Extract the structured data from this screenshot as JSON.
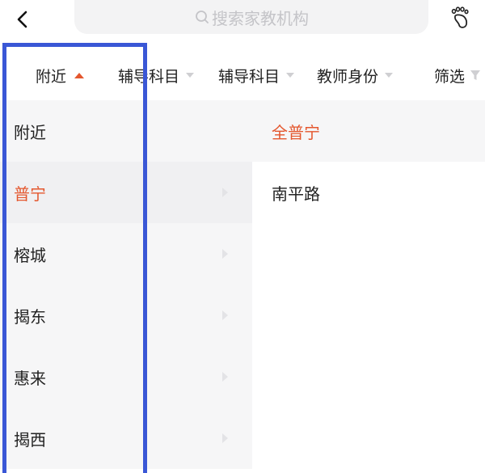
{
  "search": {
    "placeholder": "搜索家教机构"
  },
  "filters": [
    {
      "label": "附近",
      "state": "expanded"
    },
    {
      "label": "辅导科目",
      "state": "collapsed"
    },
    {
      "label": "辅导科目",
      "state": "collapsed"
    },
    {
      "label": "教师身份",
      "state": "collapsed"
    },
    {
      "label": "筛选",
      "state": "collapsed"
    }
  ],
  "left_list": {
    "items": [
      {
        "label": "附近",
        "selected": false
      },
      {
        "label": "普宁",
        "selected": true
      },
      {
        "label": "榕城",
        "selected": false
      },
      {
        "label": "揭东",
        "selected": false
      },
      {
        "label": "惠来",
        "selected": false
      },
      {
        "label": "揭西",
        "selected": false
      }
    ]
  },
  "right_list": {
    "items": [
      {
        "label": "全普宁",
        "selected": true
      },
      {
        "label": "南平路",
        "selected": false
      }
    ]
  },
  "colors": {
    "accent": "#e4572e",
    "annotation": "#3a57d6",
    "list_bg": "#f6f6f7",
    "search_bg": "#f3f3f4"
  }
}
